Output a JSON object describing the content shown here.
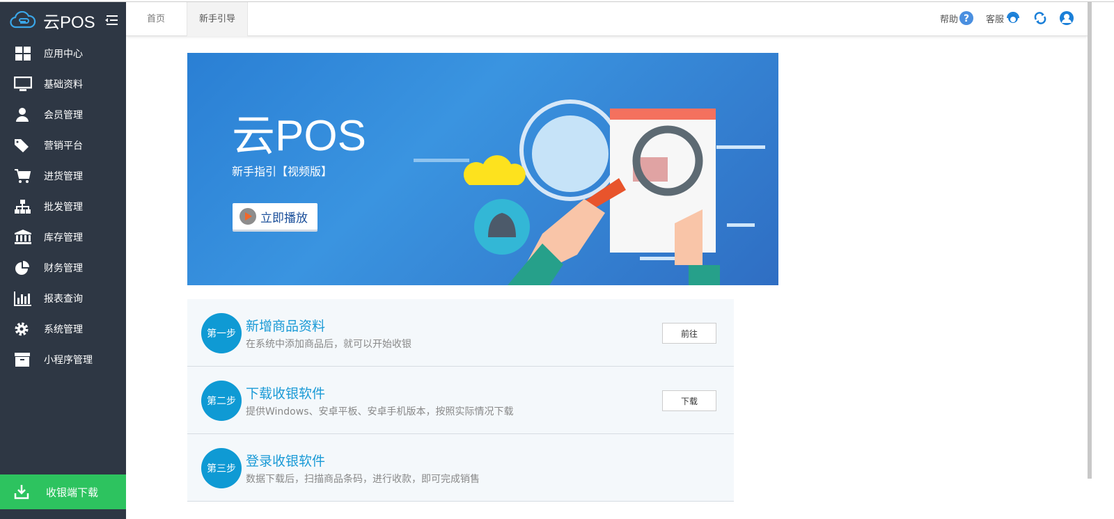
{
  "app": {
    "name": "云POS"
  },
  "sidebar": {
    "items": [
      {
        "label": "应用中心",
        "icon": "grid-icon"
      },
      {
        "label": "基础资料",
        "icon": "monitor-icon"
      },
      {
        "label": "会员管理",
        "icon": "user-icon"
      },
      {
        "label": "营销平台",
        "icon": "tags-icon"
      },
      {
        "label": "进货管理",
        "icon": "cart-icon"
      },
      {
        "label": "批发管理",
        "icon": "sitemap-icon"
      },
      {
        "label": "库存管理",
        "icon": "bank-icon"
      },
      {
        "label": "财务管理",
        "icon": "pie-chart-icon"
      },
      {
        "label": "报表查询",
        "icon": "bar-chart-icon"
      },
      {
        "label": "系统管理",
        "icon": "gear-icon"
      },
      {
        "label": "小程序管理",
        "icon": "archive-icon"
      }
    ],
    "download": "收银端下载"
  },
  "header": {
    "tabs": [
      "首页",
      "新手引导"
    ],
    "help": "帮助",
    "service": "客服"
  },
  "banner": {
    "title": "云POS",
    "subtitle": "新手指引【视频版】",
    "play": "立即播放"
  },
  "steps": [
    {
      "badge": "第一步",
      "title": "新增商品资料",
      "desc": "在系统中添加商品后，就可以开始收银",
      "button": "前往"
    },
    {
      "badge": "第二步",
      "title": "下载收银软件",
      "desc": "提供Windows、安卓平板、安卓手机版本，按照实际情况下载",
      "button": "下载"
    },
    {
      "badge": "第三步",
      "title": "登录收银软件",
      "desc": "数据下载后，扫描商品条码，进行收款，即可完成销售"
    }
  ]
}
